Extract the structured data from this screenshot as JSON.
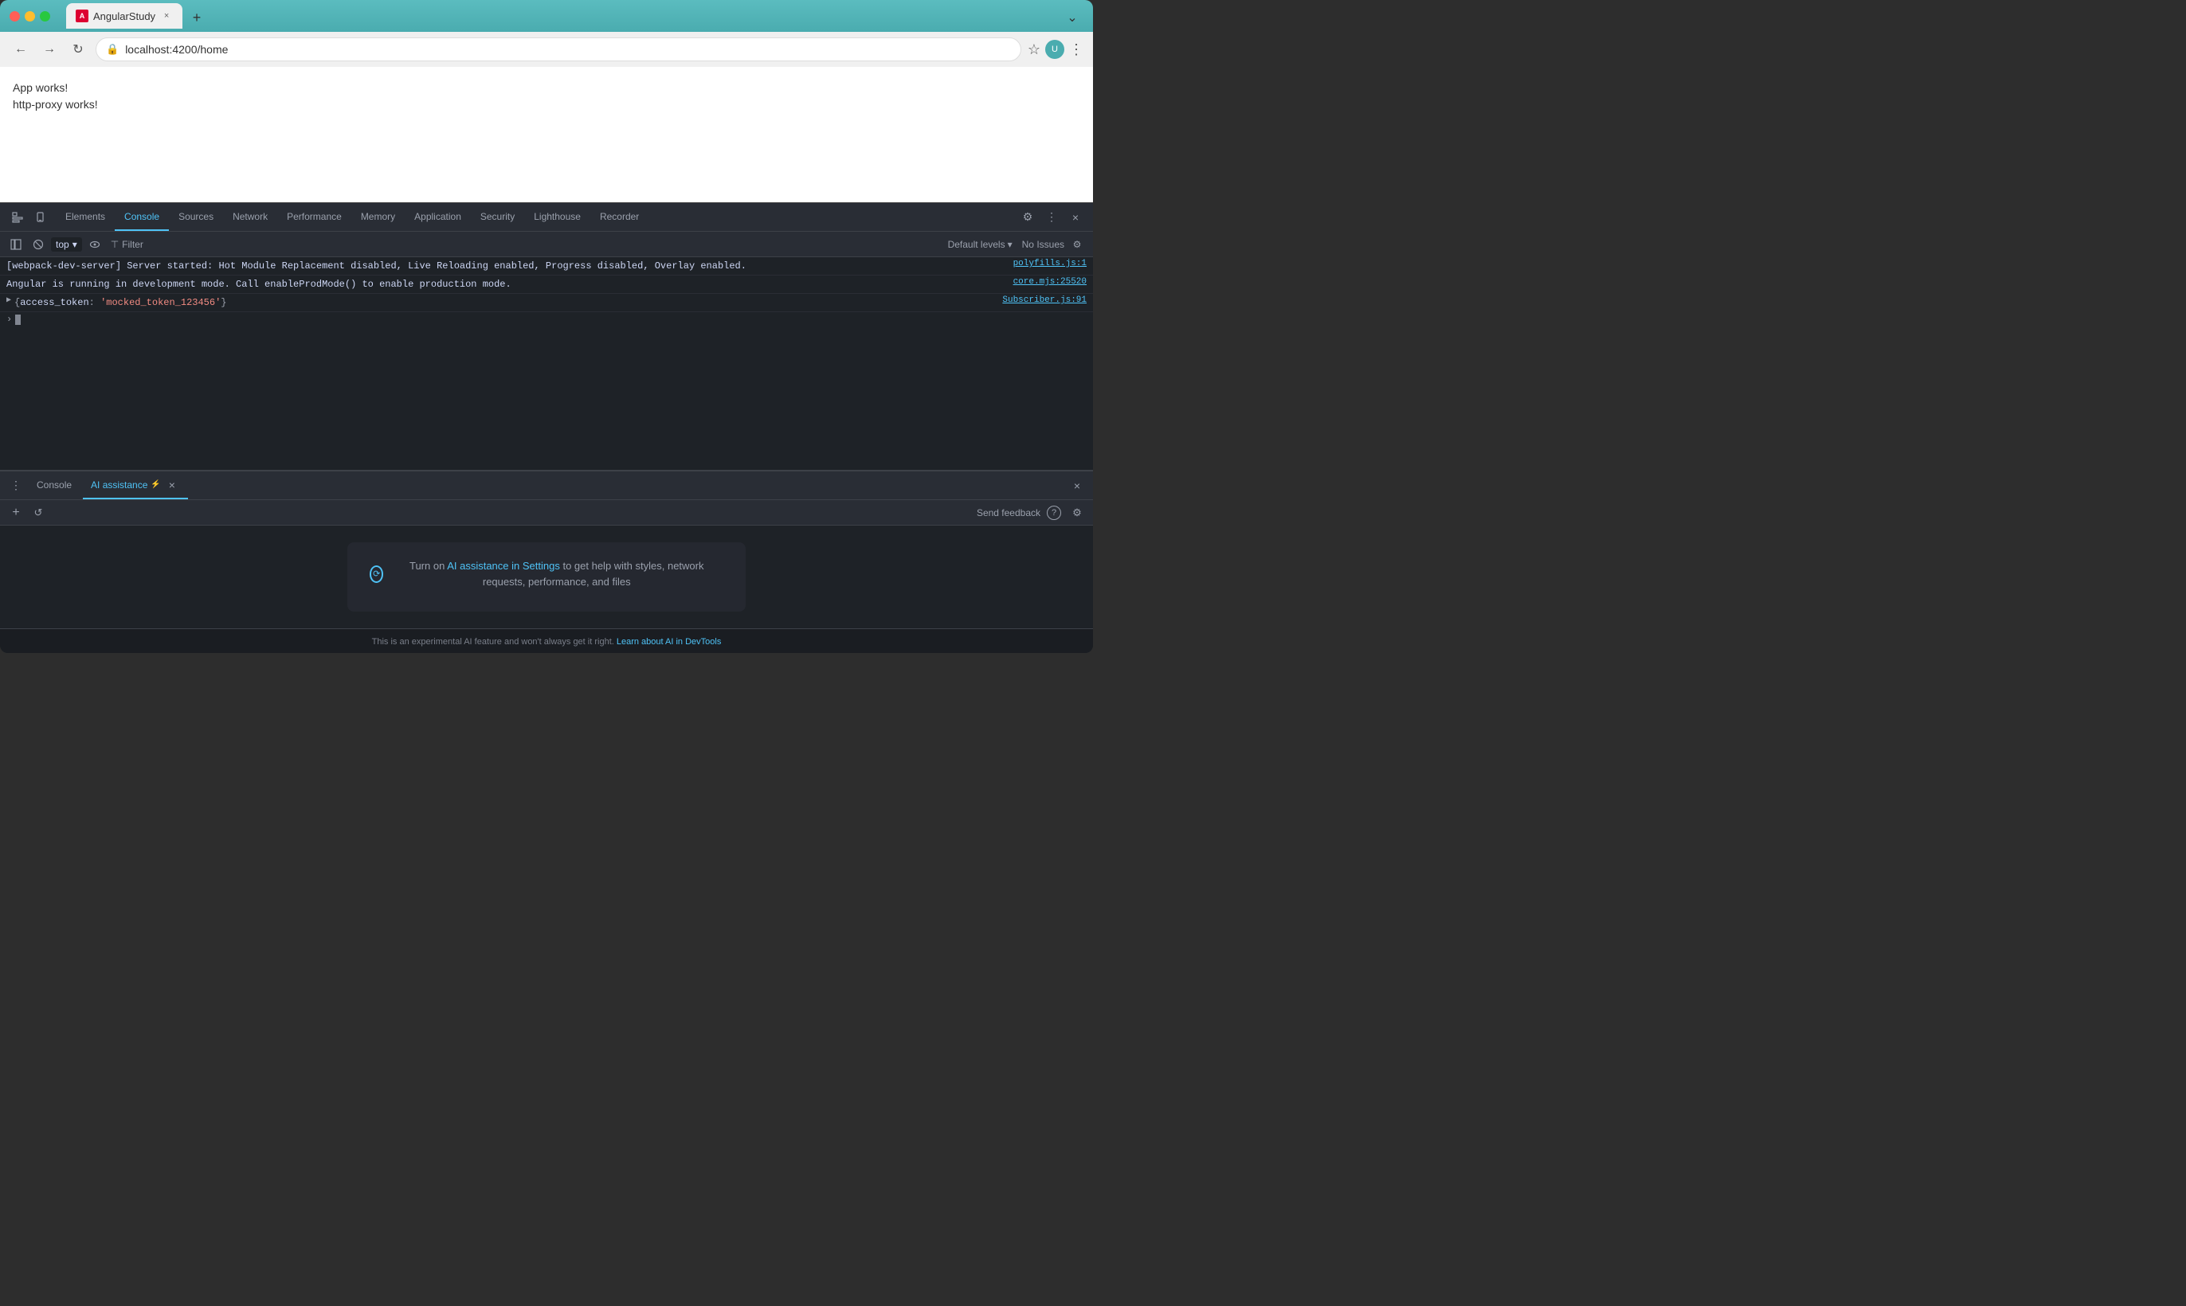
{
  "browser": {
    "tab": {
      "favicon_letter": "A",
      "title": "AngularStudy",
      "close_icon": "×",
      "new_tab_icon": "+",
      "expand_icon": "⌄"
    },
    "nav": {
      "back_icon": "←",
      "forward_icon": "→",
      "refresh_icon": "↻",
      "url": "localhost:4200/home",
      "star_icon": "☆",
      "menu_icon": "⋮"
    }
  },
  "page": {
    "line1": "App works!",
    "line2": "http-proxy works!"
  },
  "devtools": {
    "left_icons": [
      "⊞",
      "☐"
    ],
    "tabs": [
      {
        "id": "elements",
        "label": "Elements",
        "active": false
      },
      {
        "id": "console",
        "label": "Console",
        "active": true
      },
      {
        "id": "sources",
        "label": "Sources",
        "active": false
      },
      {
        "id": "network",
        "label": "Network",
        "active": false
      },
      {
        "id": "performance",
        "label": "Performance",
        "active": false
      },
      {
        "id": "memory",
        "label": "Memory",
        "active": false
      },
      {
        "id": "application",
        "label": "Application",
        "active": false
      },
      {
        "id": "security",
        "label": "Security",
        "active": false
      },
      {
        "id": "lighthouse",
        "label": "Lighthouse",
        "active": false
      },
      {
        "id": "recorder",
        "label": "Recorder",
        "active": false
      }
    ],
    "right_icons": [
      "⚙",
      "⋮",
      "×"
    ],
    "console_toolbar": {
      "sidebar_icon": "⊟",
      "clear_icon": "🚫",
      "top_label": "top",
      "top_arrow": "▾",
      "eye_icon": "👁",
      "filter_icon": "⊤",
      "filter_label": "Filter",
      "default_levels_label": "Default levels",
      "default_levels_arrow": "▾",
      "no_issues_label": "No Issues",
      "settings_icon": "⚙"
    },
    "console_output": {
      "line1": {
        "content": "[webpack-dev-server] Server started: Hot Module Replacement disabled, Live Reloading enabled, Progress disabled, Overlay enabled.",
        "source": "polyfills.js:1"
      },
      "line2": {
        "content": "Angular is running in development mode. Call enableProdMode() to enable production mode.",
        "source": "core.mjs:25520"
      },
      "line3": {
        "expand": "▶",
        "before": "{",
        "key": "access_token",
        "sep": ": ",
        "val": "'mocked_token_123456'",
        "after": "}",
        "source": "Subscriber.js:91"
      }
    }
  },
  "ai_panel": {
    "more_icon": "⋮",
    "tabs": [
      {
        "id": "console",
        "label": "Console",
        "active": false
      },
      {
        "id": "ai-assistance",
        "label": "AI assistance",
        "active": true
      }
    ],
    "ai_icon": "⚡",
    "ai_close_icon": "×",
    "panel_close_icon": "×",
    "toolbar": {
      "plus_icon": "+",
      "history_icon": "↺",
      "send_feedback_label": "Send feedback",
      "help_icon": "?",
      "settings_icon": "⚙"
    },
    "card": {
      "icon_symbol": "⟳",
      "text_before": "Turn on ",
      "link_text": "AI assistance in Settings",
      "text_after": " to get help with styles, network requests, performance, and files"
    },
    "footer": {
      "text": "This is an experimental AI feature and won't always get it right. ",
      "link_text": "Learn about AI in DevTools"
    }
  }
}
